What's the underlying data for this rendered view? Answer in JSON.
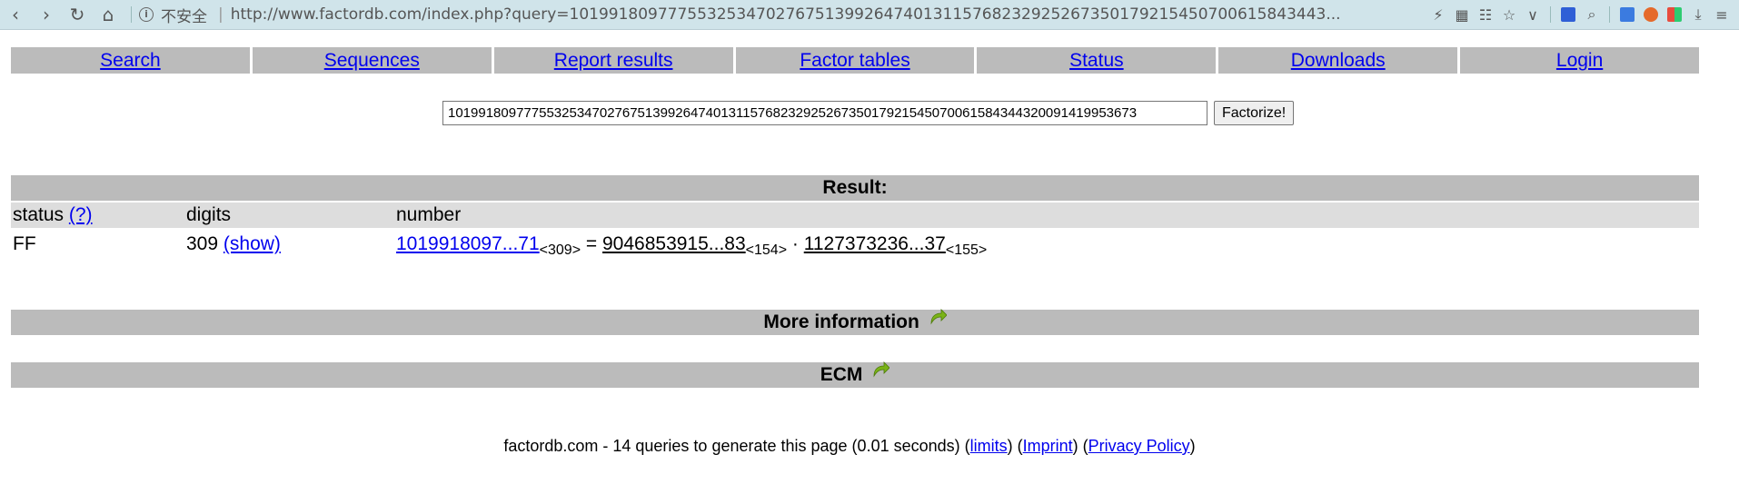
{
  "browser": {
    "security_label": "不安全",
    "url": "http://www.factordb.com/index.php?query=10199180977755325347027675139926474013115768232925267350179215450700615843443..."
  },
  "menu": {
    "items": [
      "Search",
      "Sequences",
      "Report results",
      "Factor tables",
      "Status",
      "Downloads",
      "Login"
    ]
  },
  "search": {
    "query_value": "1019918097775532534702767513992647401311576823292526735017921545070061584344320091419953673",
    "button_label": "Factorize!"
  },
  "result": {
    "heading": "Result:",
    "columns": [
      "status",
      "digits",
      "number"
    ],
    "status_help": "(?)",
    "row": {
      "status": "FF",
      "digits": "309",
      "show_link": "(show)",
      "number": "1019918097...71",
      "number_digits": "<309>",
      "equals": "=",
      "factor1": "9046853915...83",
      "factor1_digits": "<154>",
      "times": "·",
      "factor2": "1127373236...37",
      "factor2_digits": "<155>"
    }
  },
  "sections": {
    "more_info": "More information",
    "ecm": "ECM"
  },
  "footer": {
    "prefix": "factordb.com - 14 queries to generate this page (0.01 seconds) (",
    "limits": "limits",
    "sep1": ") (",
    "imprint": "Imprint",
    "sep2": ") (",
    "privacy": "Privacy Policy",
    "suffix": ")"
  },
  "colors": {
    "chrome_bg": "#d0e4ea",
    "bar_gray": "#bbbbbb",
    "header_row_gray": "#dddddd",
    "link_blue": "#0000ee",
    "refresh_green": "#7ab317"
  }
}
